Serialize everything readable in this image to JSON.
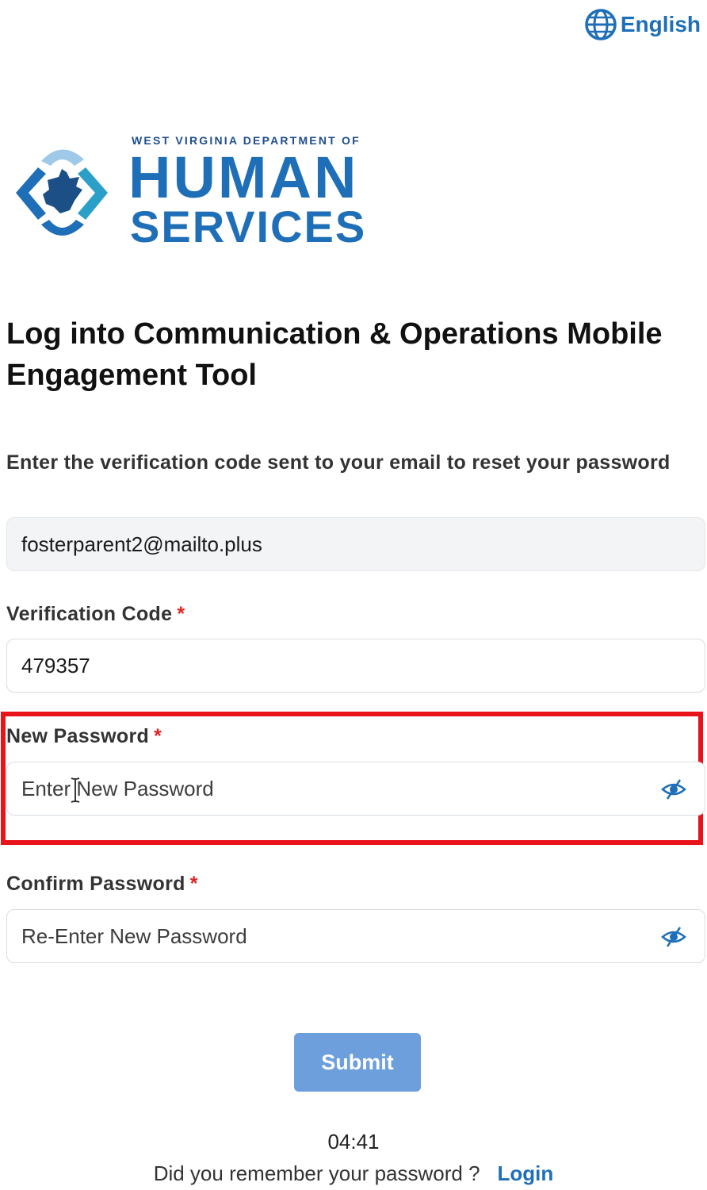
{
  "language": {
    "label": "English",
    "icon": "globe-icon"
  },
  "logo": {
    "department_line": "WEST VIRGINIA DEPARTMENT OF",
    "line1": "HUMAN",
    "line2": "SERVICES"
  },
  "heading": "Log into Communication & Operations Mobile Engagement Tool",
  "instruction": "Enter the verification code sent to your email to reset your password",
  "email_field": {
    "value": "fosterparent2@mailto.plus"
  },
  "verification_code": {
    "label": "Verification Code",
    "required_mark": "*",
    "value": "479357"
  },
  "new_password": {
    "label": "New Password",
    "required_mark": "*",
    "placeholder": "Enter New Password",
    "icon": "eye-slash-icon"
  },
  "confirm_password": {
    "label": "Confirm Password",
    "required_mark": "*",
    "placeholder": "Re-Enter New Password",
    "icon": "eye-slash-icon"
  },
  "submit_label": "Submit",
  "timer": "04:41",
  "footer": {
    "question": "Did you remember your password ?",
    "login_label": "Login"
  },
  "colors": {
    "brand_blue": "#1f6fb8",
    "button_blue": "#6d9fdc",
    "required_red": "#e02424",
    "highlight_red": "#e8141a"
  }
}
